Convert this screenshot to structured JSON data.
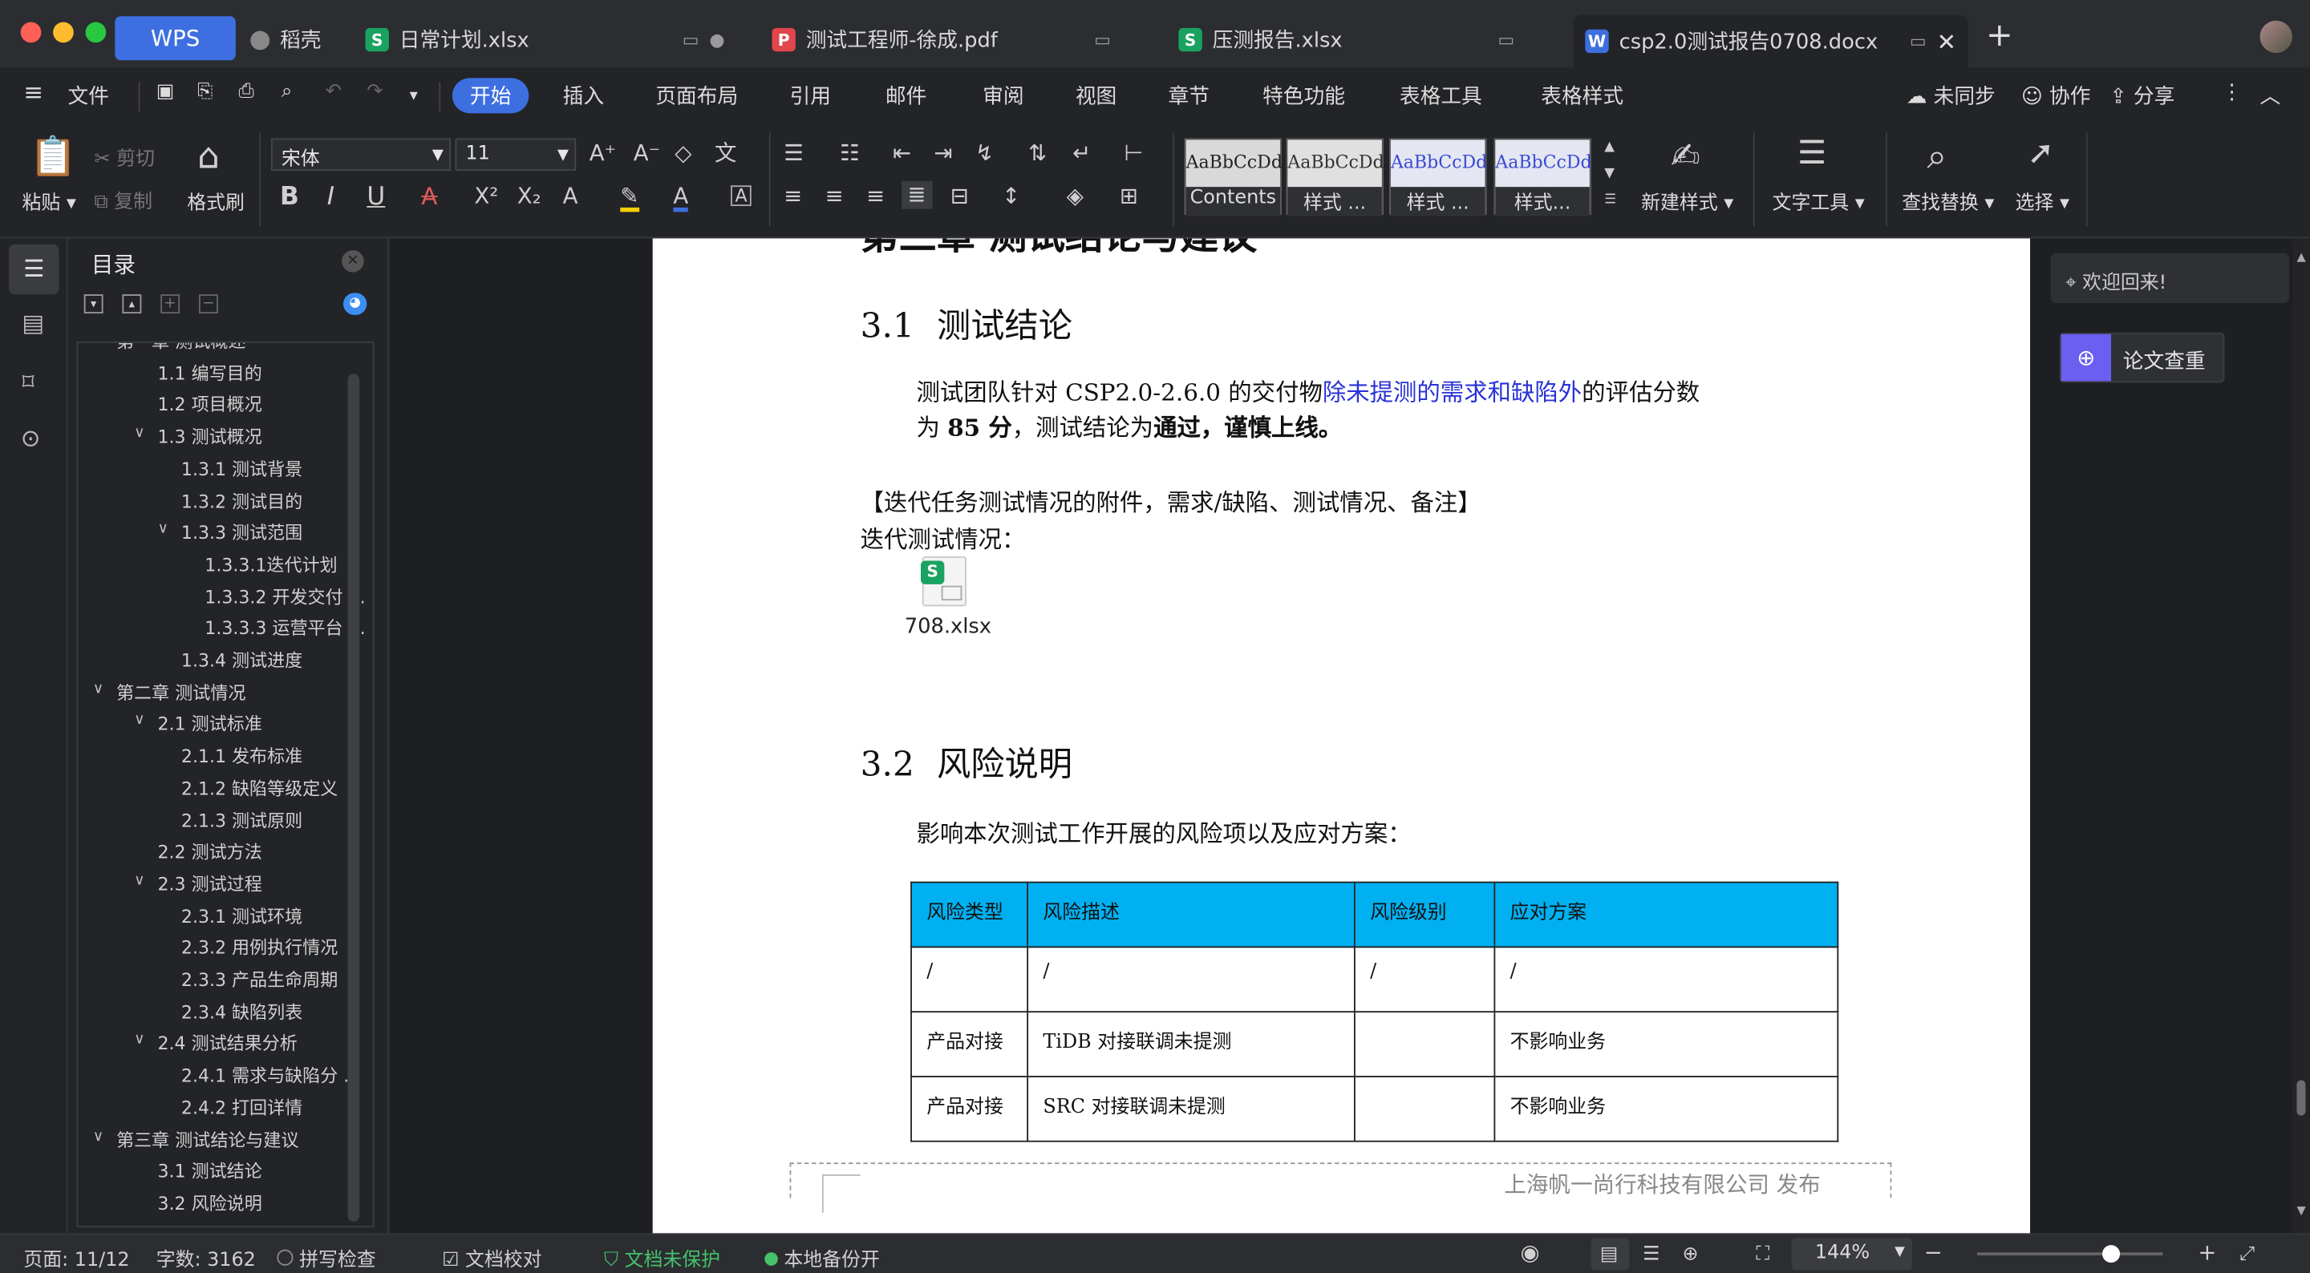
{
  "titlebar": {
    "tabs": [
      {
        "label": "WPS"
      },
      {
        "label": "稻壳"
      },
      {
        "label": "日常计划.xlsx",
        "icon": "S"
      },
      {
        "label": "测试工程师-徐成.pdf",
        "icon": "P"
      },
      {
        "label": "压测报告.xlsx",
        "icon": "S"
      },
      {
        "label": "csp2.0测试报告0708.docx",
        "icon": "W"
      }
    ],
    "new_tab": "+"
  },
  "menubar": {
    "file": "文件",
    "items": [
      "开始",
      "插入",
      "页面布局",
      "引用",
      "邮件",
      "审阅",
      "视图",
      "章节",
      "特色功能",
      "表格工具",
      "表格样式"
    ],
    "sync": "未同步",
    "collab": "协作",
    "share": "分享"
  },
  "ribbon": {
    "paste": "粘贴",
    "cut": "剪切",
    "copy": "复制",
    "format_painter": "格式刷",
    "font_name": "宋体",
    "font_size": "11",
    "styles": [
      {
        "sample": "AaBbCcDd",
        "name": "Contents"
      },
      {
        "sample": "AaBbCcDd",
        "name": "样式 ..."
      },
      {
        "sample": "AaBbCcDd",
        "name": "样式 ..."
      },
      {
        "sample": "AaBbCcDd",
        "name": "样式..."
      }
    ],
    "new_style": "新建样式",
    "text_tools": "文字工具",
    "find_replace": "查找替换",
    "select": "选择"
  },
  "toc": {
    "title": "目录",
    "items": [
      {
        "label": "第一章 测试概述",
        "level": 0
      },
      {
        "label": "1.1 编写目的",
        "level": 1
      },
      {
        "label": "1.2 项目概况",
        "level": 1
      },
      {
        "label": "1.3 测试概况",
        "level": 1
      },
      {
        "label": "1.3.1 测试背景",
        "level": 2
      },
      {
        "label": "1.3.2 测试目的",
        "level": 2
      },
      {
        "label": "1.3.3 测试范围",
        "level": 2
      },
      {
        "label": "1.3.3.1迭代计划",
        "level": 3
      },
      {
        "label": "1.3.3.2 开发交付 ...",
        "level": 3
      },
      {
        "label": "1.3.3.3 运营平台 ...",
        "level": 3
      },
      {
        "label": "1.3.4 测试进度",
        "level": 2
      },
      {
        "label": "第二章 测试情况",
        "level": 0
      },
      {
        "label": "2.1 测试标准",
        "level": 1
      },
      {
        "label": "2.1.1 发布标准",
        "level": 2
      },
      {
        "label": "2.1.2 缺陷等级定义",
        "level": 2
      },
      {
        "label": "2.1.3 测试原则",
        "level": 2
      },
      {
        "label": "2.2 测试方法",
        "level": 1
      },
      {
        "label": "2.3 测试过程",
        "level": 1
      },
      {
        "label": "2.3.1 测试环境",
        "level": 2
      },
      {
        "label": "2.3.2 用例执行情况",
        "level": 2
      },
      {
        "label": "2.3.3 产品生命周期",
        "level": 2
      },
      {
        "label": "2.3.4 缺陷列表",
        "level": 2
      },
      {
        "label": "2.4 测试结果分析",
        "level": 1
      },
      {
        "label": "2.4.1 需求与缺陷分 ...",
        "level": 2
      },
      {
        "label": "2.4.2 打回详情",
        "level": 2
      },
      {
        "label": "第三章 测试结论与建议",
        "level": 0
      },
      {
        "label": "3.1 测试结论",
        "level": 1
      },
      {
        "label": "3.2 风险说明",
        "level": 1
      }
    ]
  },
  "document": {
    "chapter_heading": "第三章 测试结论与建议",
    "h31_num": "3.1",
    "h31_text": "测试结论",
    "p1_a": "测试团队针对 CSP2.0-2.6.0 的交付物",
    "p1_link": "除未提测的需求和缺陷外",
    "p1_b": "的评估分数",
    "p1_c": "为 ",
    "p1_score": "85 分",
    "p1_d": "，测试结论为",
    "p1_e": "通过，谨慎上线。",
    "attach_note": "【迭代任务测试情况的附件，需求/缺陷、测试情况、备注】",
    "iter_label": "迭代测试情况：",
    "attachment_name": "708.xlsx",
    "h32_num": "3.2",
    "h32_text": "风险说明",
    "p2": "影响本次测试工作开展的风险项以及应对方案：",
    "table": {
      "headers": [
        "风险类型",
        "风险描述",
        "风险级别",
        "应对方案"
      ],
      "rows": [
        [
          "/",
          "/",
          "/",
          "/"
        ],
        [
          "产品对接",
          "TiDB 对接联调未提测",
          "",
          "不影响业务"
        ],
        [
          "产品对接",
          "SRC  对接联调未提测",
          "",
          "不影响业务"
        ]
      ]
    },
    "footer": "上海帆一尚行科技有限公司  发布"
  },
  "rightpanel": {
    "welcome": "欢迎回来!",
    "paper_check": "论文查重"
  },
  "status": {
    "page": "页面: 11/12",
    "words": "字数: 3162",
    "spell": "拼写检查",
    "proof": "文档校对",
    "protect": "文档未保护",
    "backup": "本地备份开",
    "zoom": "144%",
    "zoom_level": 0.72
  }
}
